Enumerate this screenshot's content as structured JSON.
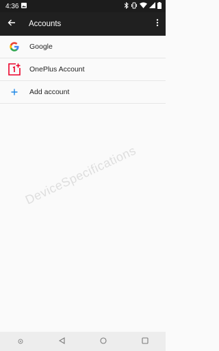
{
  "status_bar": {
    "time": "4:36",
    "icons": [
      "image-notification-icon",
      "bluetooth-icon",
      "vibrate-icon",
      "wifi-icon",
      "signal-icon",
      "battery-icon"
    ]
  },
  "app_bar": {
    "title": "Accounts",
    "back_icon": "arrow-back-icon",
    "overflow_icon": "more-vertical-icon"
  },
  "accounts": [
    {
      "label": "Google",
      "icon": "google-icon"
    },
    {
      "label": "OnePlus Account",
      "icon": "oneplus-icon"
    },
    {
      "label": "Add account",
      "icon": "plus-icon"
    }
  ],
  "watermark": {
    "text": "DeviceSpecifications"
  },
  "colors": {
    "status_bar": "#1c1c1c",
    "app_bar": "#202020",
    "background": "#fafafa",
    "oneplus_red": "#eb0029",
    "accent_blue": "#1e88e5",
    "nav_bar": "#ededed"
  },
  "nav_bar": {
    "buttons": [
      "assistant-dot-icon",
      "back-triangle-icon",
      "home-circle-icon",
      "recents-square-icon"
    ]
  }
}
